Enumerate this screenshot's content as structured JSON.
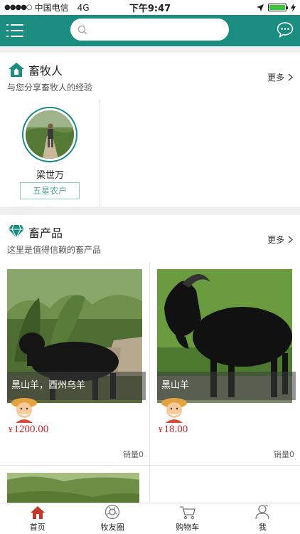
{
  "status": {
    "carrier": "中国电信",
    "network": "4G",
    "time": "下午9:47"
  },
  "search": {
    "placeholder": ""
  },
  "herders": {
    "title": "畜牧人",
    "subtitle": "与您分享畜牧人的经验",
    "more": "更多",
    "items": [
      {
        "name": "梁世万",
        "badge": "五星农户"
      }
    ]
  },
  "products": {
    "title": "畜产品",
    "subtitle": "这里是值得信赖的畜产品",
    "more": "更多",
    "items": [
      {
        "name": "黑山羊，酉州乌羊",
        "currency": "¥",
        "price": "1200.00",
        "sales": "销量0"
      },
      {
        "name": "黑山羊",
        "currency": "¥",
        "price": "18.00",
        "sales": "销量0"
      }
    ]
  },
  "colors": {
    "brand": "#1a8c80",
    "price": "#c0272d",
    "tab_active": "#c0392b"
  },
  "tabs": [
    {
      "label": "首页",
      "icon": "home-icon"
    },
    {
      "label": "牧友圈",
      "icon": "camera-circle-icon"
    },
    {
      "label": "购物车",
      "icon": "cart-icon"
    },
    {
      "label": "我",
      "icon": "user-icon"
    }
  ]
}
